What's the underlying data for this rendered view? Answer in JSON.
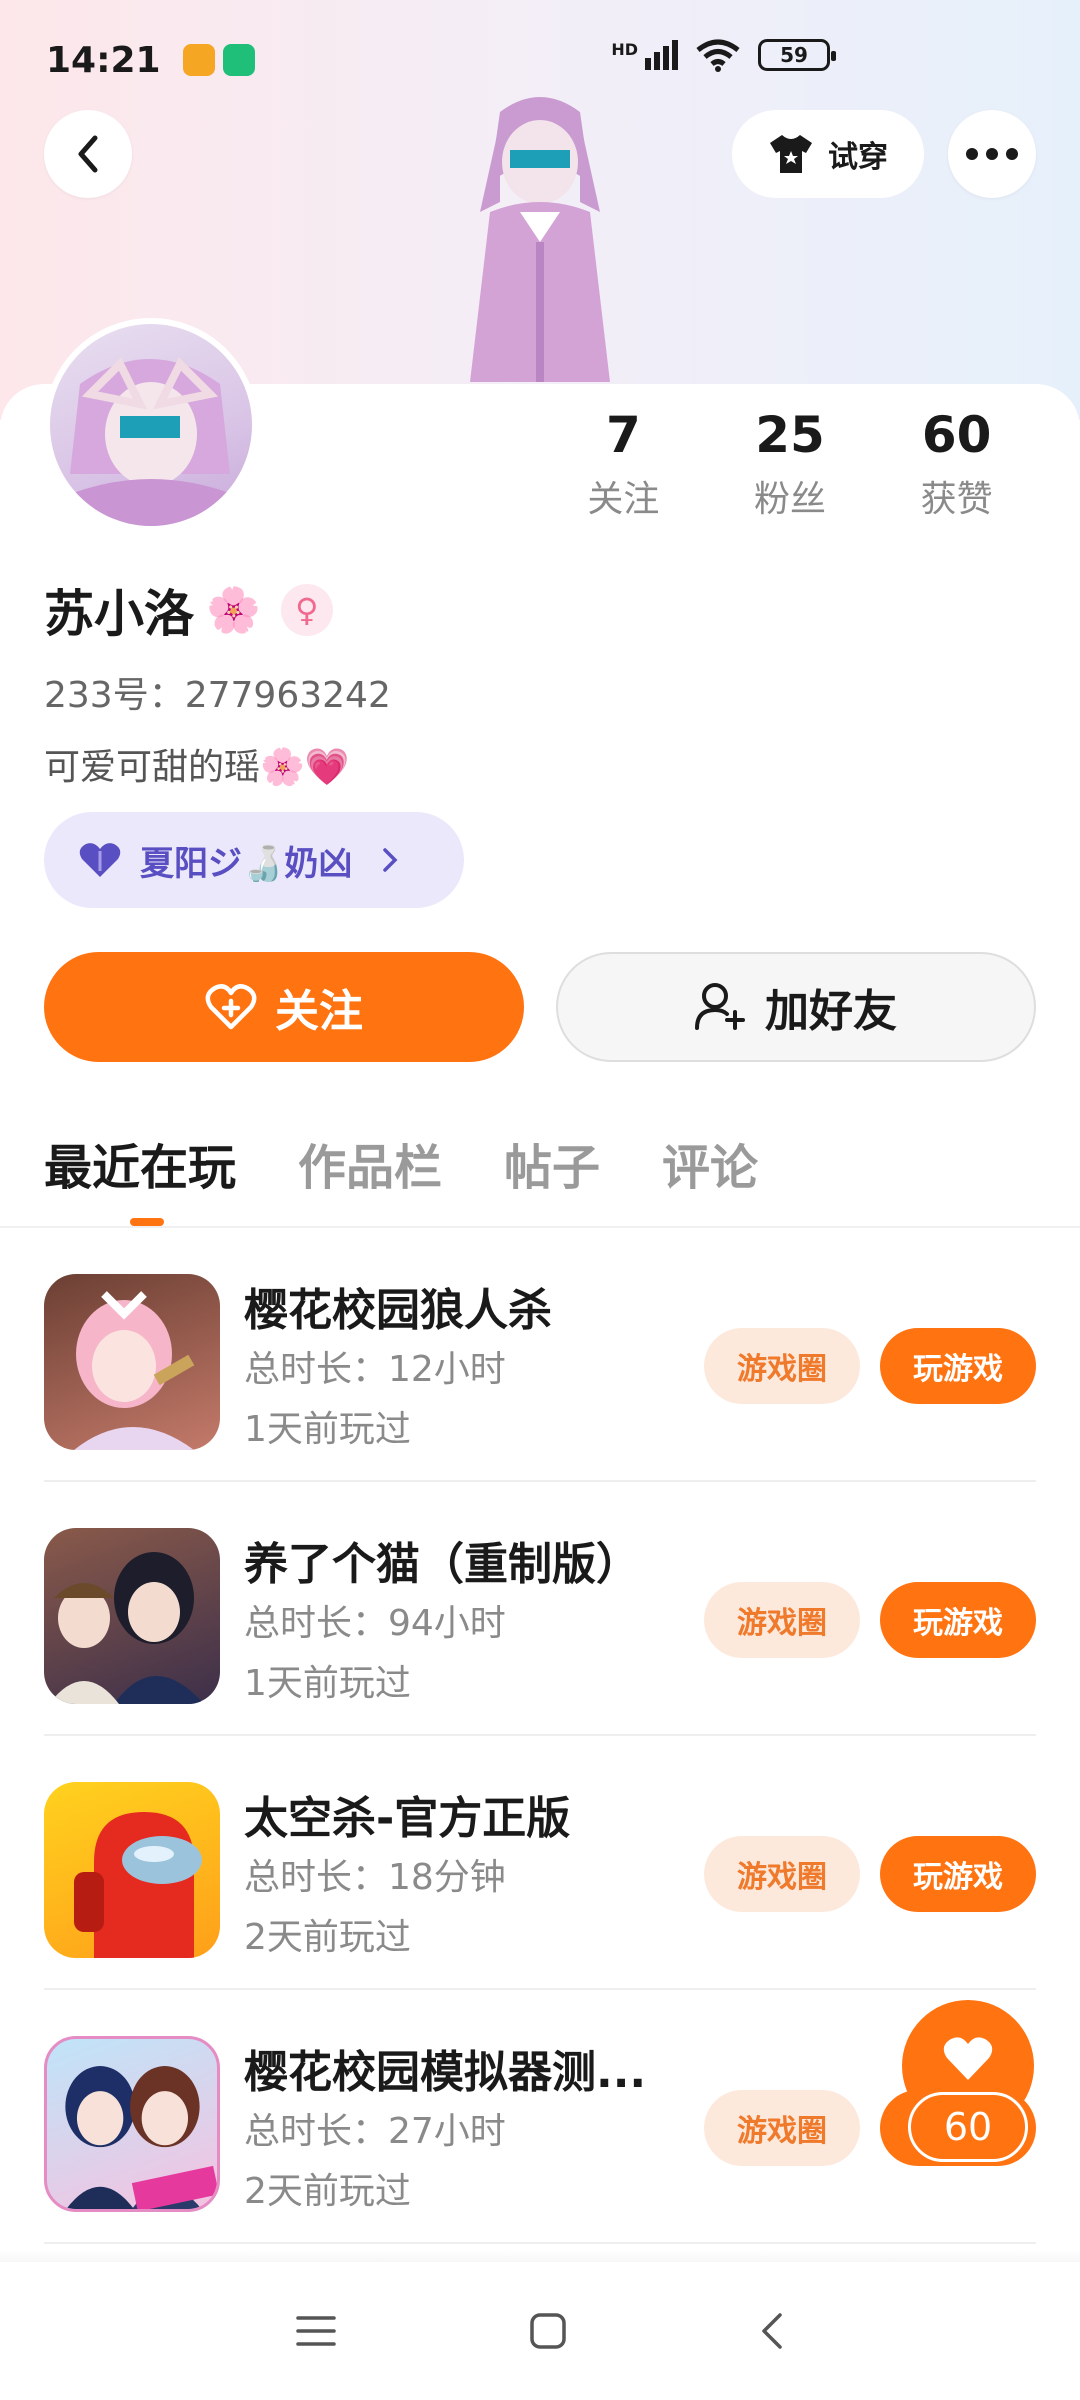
{
  "status_bar": {
    "time": "14:21",
    "network": "HD",
    "battery": "59"
  },
  "header": {
    "try_on_label": "试穿"
  },
  "profile": {
    "name": "苏小洛",
    "name_emoji": "🌸",
    "uid": "233号：277963242",
    "bio": "可爱可甜的瑶🌸💗",
    "group_tag": "夏阳ジ🍶奶凶",
    "stats": [
      {
        "num": "7",
        "label": "关注"
      },
      {
        "num": "25",
        "label": "粉丝"
      },
      {
        "num": "60",
        "label": "获赞"
      }
    ]
  },
  "actions": {
    "follow": "关注",
    "add_friend": "加好友"
  },
  "tabs": [
    "最近在玩",
    "作品栏",
    "帖子",
    "评论"
  ],
  "games": [
    {
      "title": "樱花校园狼人杀",
      "duration": "总时长：12小时",
      "last_played": "1天前玩过",
      "circle": "游戏圈",
      "play": "玩游戏"
    },
    {
      "title": "养了个猫（重制版）",
      "duration": "总时长：94小时",
      "last_played": "1天前玩过",
      "circle": "游戏圈",
      "play": "玩游戏"
    },
    {
      "title": "太空杀-官方正版",
      "duration": "总时长：18分钟",
      "last_played": "2天前玩过",
      "circle": "游戏圈",
      "play": "玩游戏"
    },
    {
      "title": "樱花校园模拟器测...",
      "duration": "总时长：27小时",
      "last_played": "2天前玩过",
      "circle": "游戏圈",
      "play": "玩游戏"
    }
  ],
  "like_fab": {
    "count": "60"
  },
  "colors": {
    "accent": "#ff7311",
    "accent_soft": "#fde9dc",
    "group_tag_bg": "#ece8fb",
    "group_tag_text": "#5a4fc2"
  }
}
